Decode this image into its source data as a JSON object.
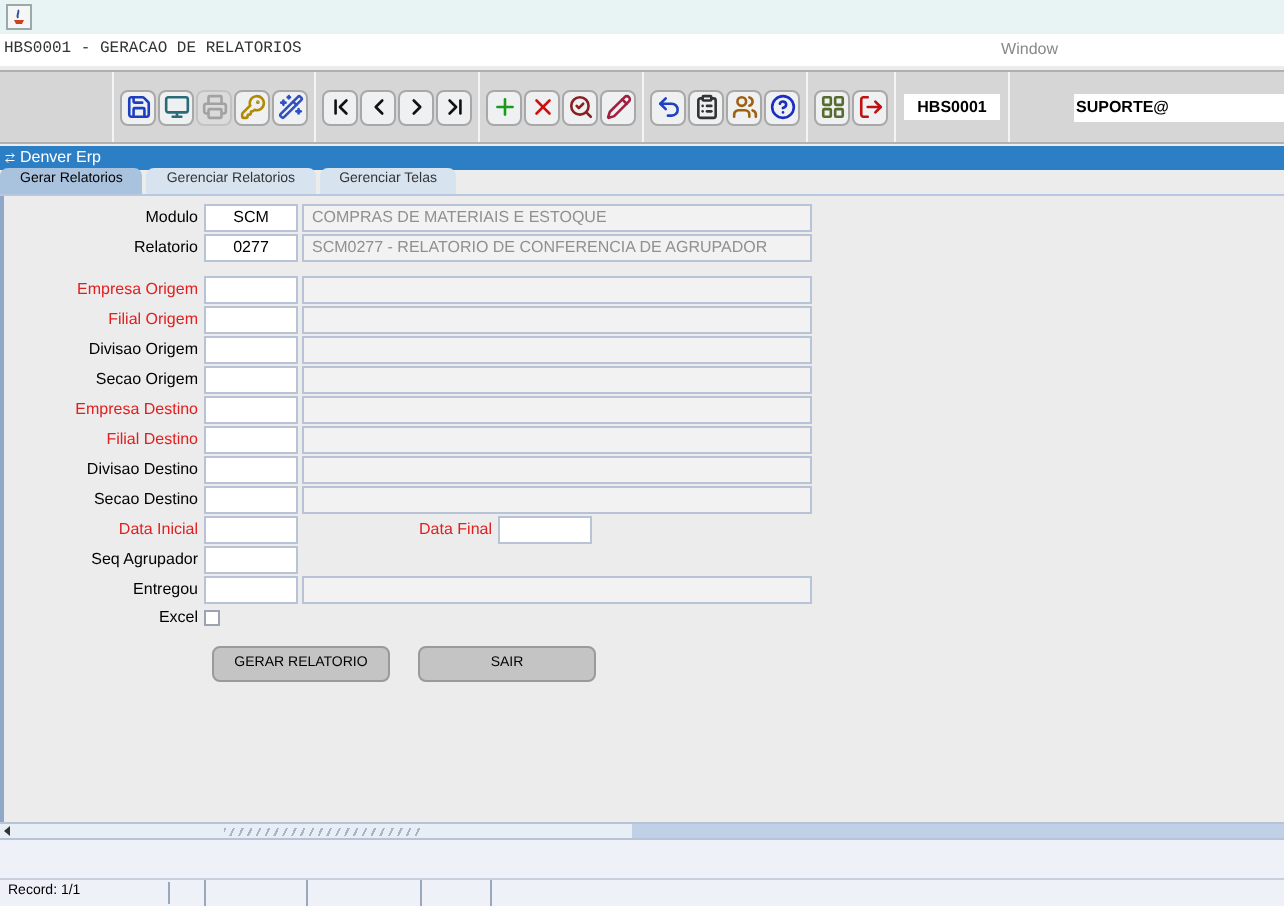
{
  "window": {
    "title": "HBS0001 - GERACAO DE RELATORIOS",
    "menu": "Window"
  },
  "toolbar": {
    "groups": [
      [
        {
          "kind": "save",
          "disabled": false
        },
        {
          "kind": "monitor",
          "disabled": false
        },
        {
          "kind": "print",
          "disabled": true
        },
        {
          "kind": "key",
          "disabled": false
        },
        {
          "kind": "wand",
          "disabled": false
        }
      ],
      [
        {
          "kind": "first",
          "disabled": false
        },
        {
          "kind": "prev",
          "disabled": false
        },
        {
          "kind": "next",
          "disabled": false
        },
        {
          "kind": "last",
          "disabled": false
        }
      ],
      [
        {
          "kind": "add",
          "disabled": false
        },
        {
          "kind": "delete",
          "disabled": false
        },
        {
          "kind": "query",
          "disabled": false
        },
        {
          "kind": "edit",
          "disabled": false
        }
      ],
      [
        {
          "kind": "undo",
          "disabled": false
        },
        {
          "kind": "clipboard",
          "disabled": false
        },
        {
          "kind": "users",
          "disabled": false
        },
        {
          "kind": "help",
          "disabled": false
        }
      ],
      [
        {
          "kind": "menu",
          "disabled": false
        },
        {
          "kind": "exit",
          "disabled": false
        }
      ]
    ],
    "form_code": "HBS0001",
    "user": "SUPORTE@"
  },
  "app_bar": {
    "title": "Denver Erp"
  },
  "tabs": [
    {
      "label": "Gerar Relatorios",
      "selected": true
    },
    {
      "label": "Gerenciar Relatorios",
      "selected": false
    },
    {
      "label": "Gerenciar Telas",
      "selected": false
    }
  ],
  "form": {
    "fields": [
      {
        "kind": "pair",
        "label": "Modulo",
        "required": false,
        "code": "SCM",
        "description": "COMPRAS DE MATERIAIS E ESTOQUE"
      },
      {
        "kind": "pair",
        "label": "Relatorio",
        "required": false,
        "code": "0277",
        "description": "SCM0277 - RELATORIO DE CONFERENCIA DE AGRUPADOR"
      },
      {
        "kind": "spacer"
      },
      {
        "kind": "pair",
        "label": "Empresa Origem",
        "required": true
      },
      {
        "kind": "pair",
        "label": "Filial Origem",
        "required": true
      },
      {
        "kind": "pair",
        "label": "Divisao Origem",
        "required": false
      },
      {
        "kind": "pair",
        "label": "Secao Origem",
        "required": false
      },
      {
        "kind": "pair",
        "label": "Empresa Destino",
        "required": true
      },
      {
        "kind": "pair",
        "label": "Filial Destino",
        "required": true
      },
      {
        "kind": "pair",
        "label": "Divisao Destino",
        "required": false
      },
      {
        "kind": "pair",
        "label": "Secao Destino",
        "required": false
      },
      {
        "kind": "dates",
        "label": "Data Inicial",
        "required": true,
        "label2": "Data Final"
      },
      {
        "kind": "single",
        "label": "Seq Agrupador",
        "required": false
      },
      {
        "kind": "pair",
        "label": "Entregou",
        "required": false
      },
      {
        "kind": "checkbox",
        "label": "Excel",
        "required": false,
        "checked": false
      }
    ],
    "buttons": [
      "GERAR RELATORIO",
      "SAIR"
    ]
  },
  "status_bar": {
    "record": "Record: 1/1"
  }
}
